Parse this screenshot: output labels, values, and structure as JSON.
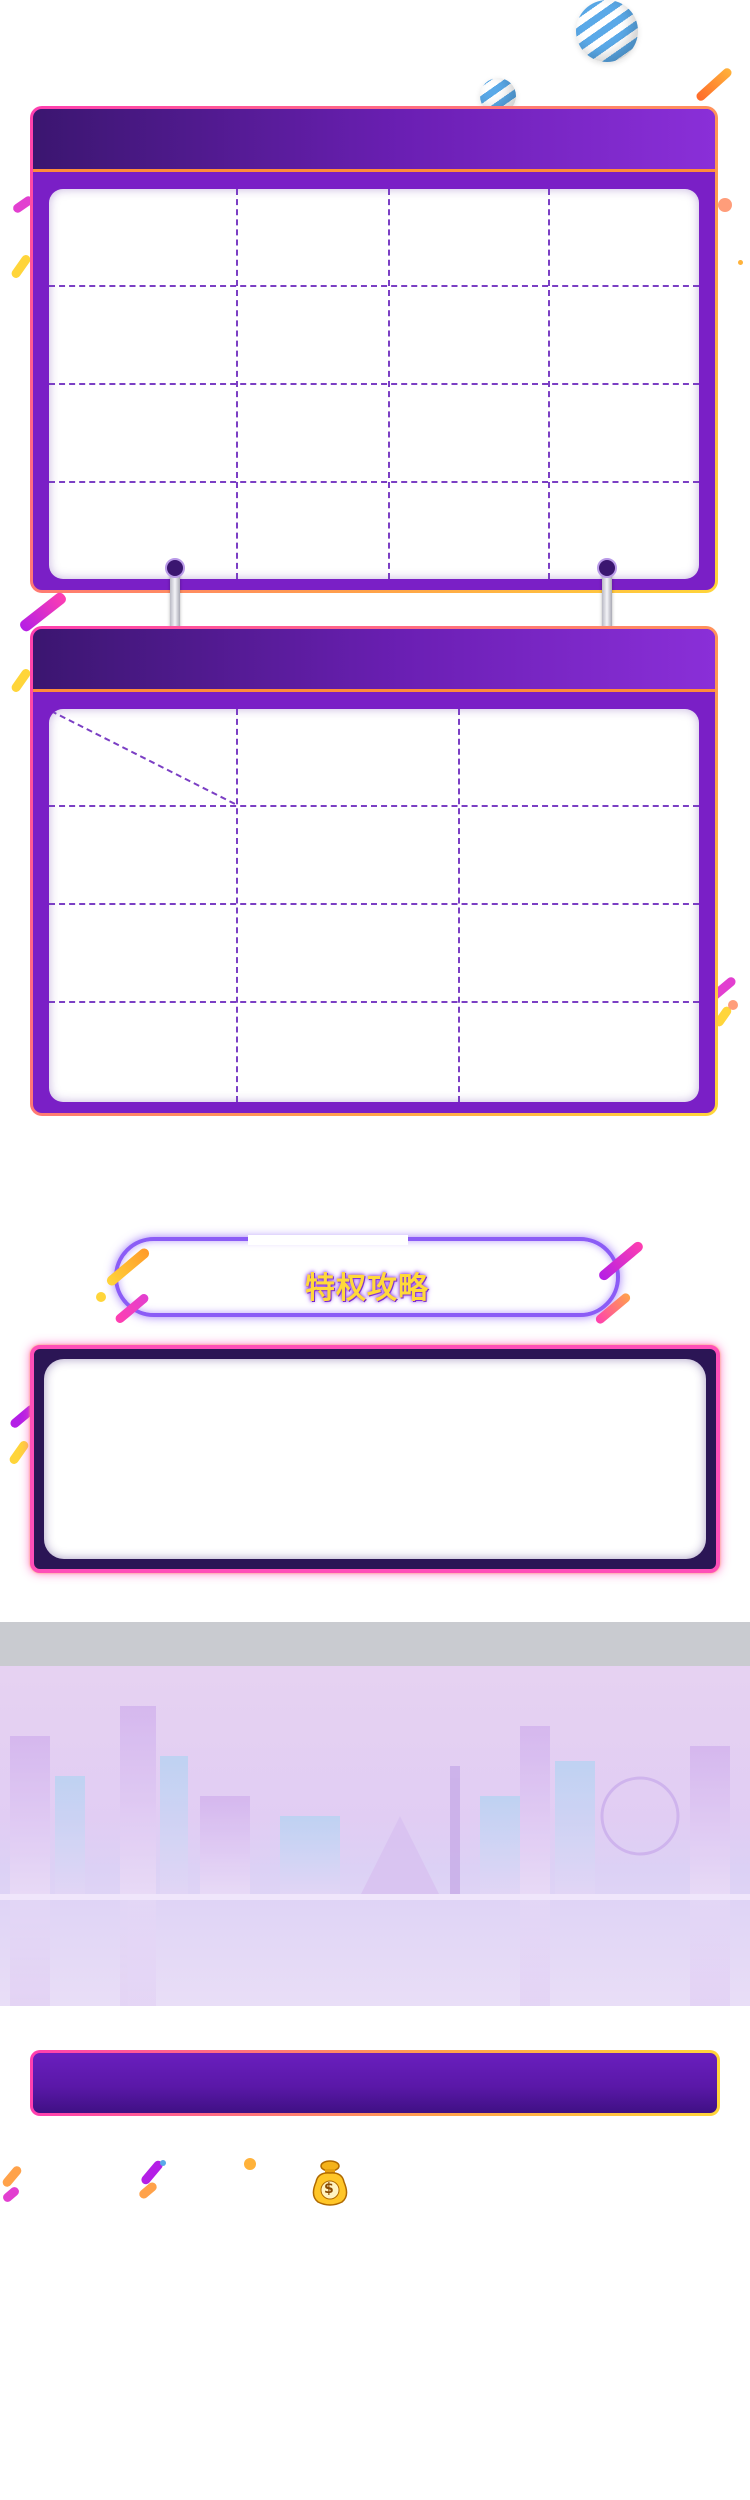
{
  "banner": {
    "title": "特权攻略"
  },
  "icons": {
    "decor_ball": "striped-ball-icon",
    "money_bag": "money-bag-icon",
    "dollar_sign": "$"
  },
  "colors": {
    "panel_purple": "#7a1fc6",
    "panel_head_dark": "#3b1670",
    "border_pink": "#ff3fb0",
    "border_orange": "#ffa24a",
    "border_yellow": "#ffd53a",
    "grid_line": "#7b3fc4",
    "banner_text": "#ffd93a",
    "banner_ring": "#8b5cf6"
  }
}
